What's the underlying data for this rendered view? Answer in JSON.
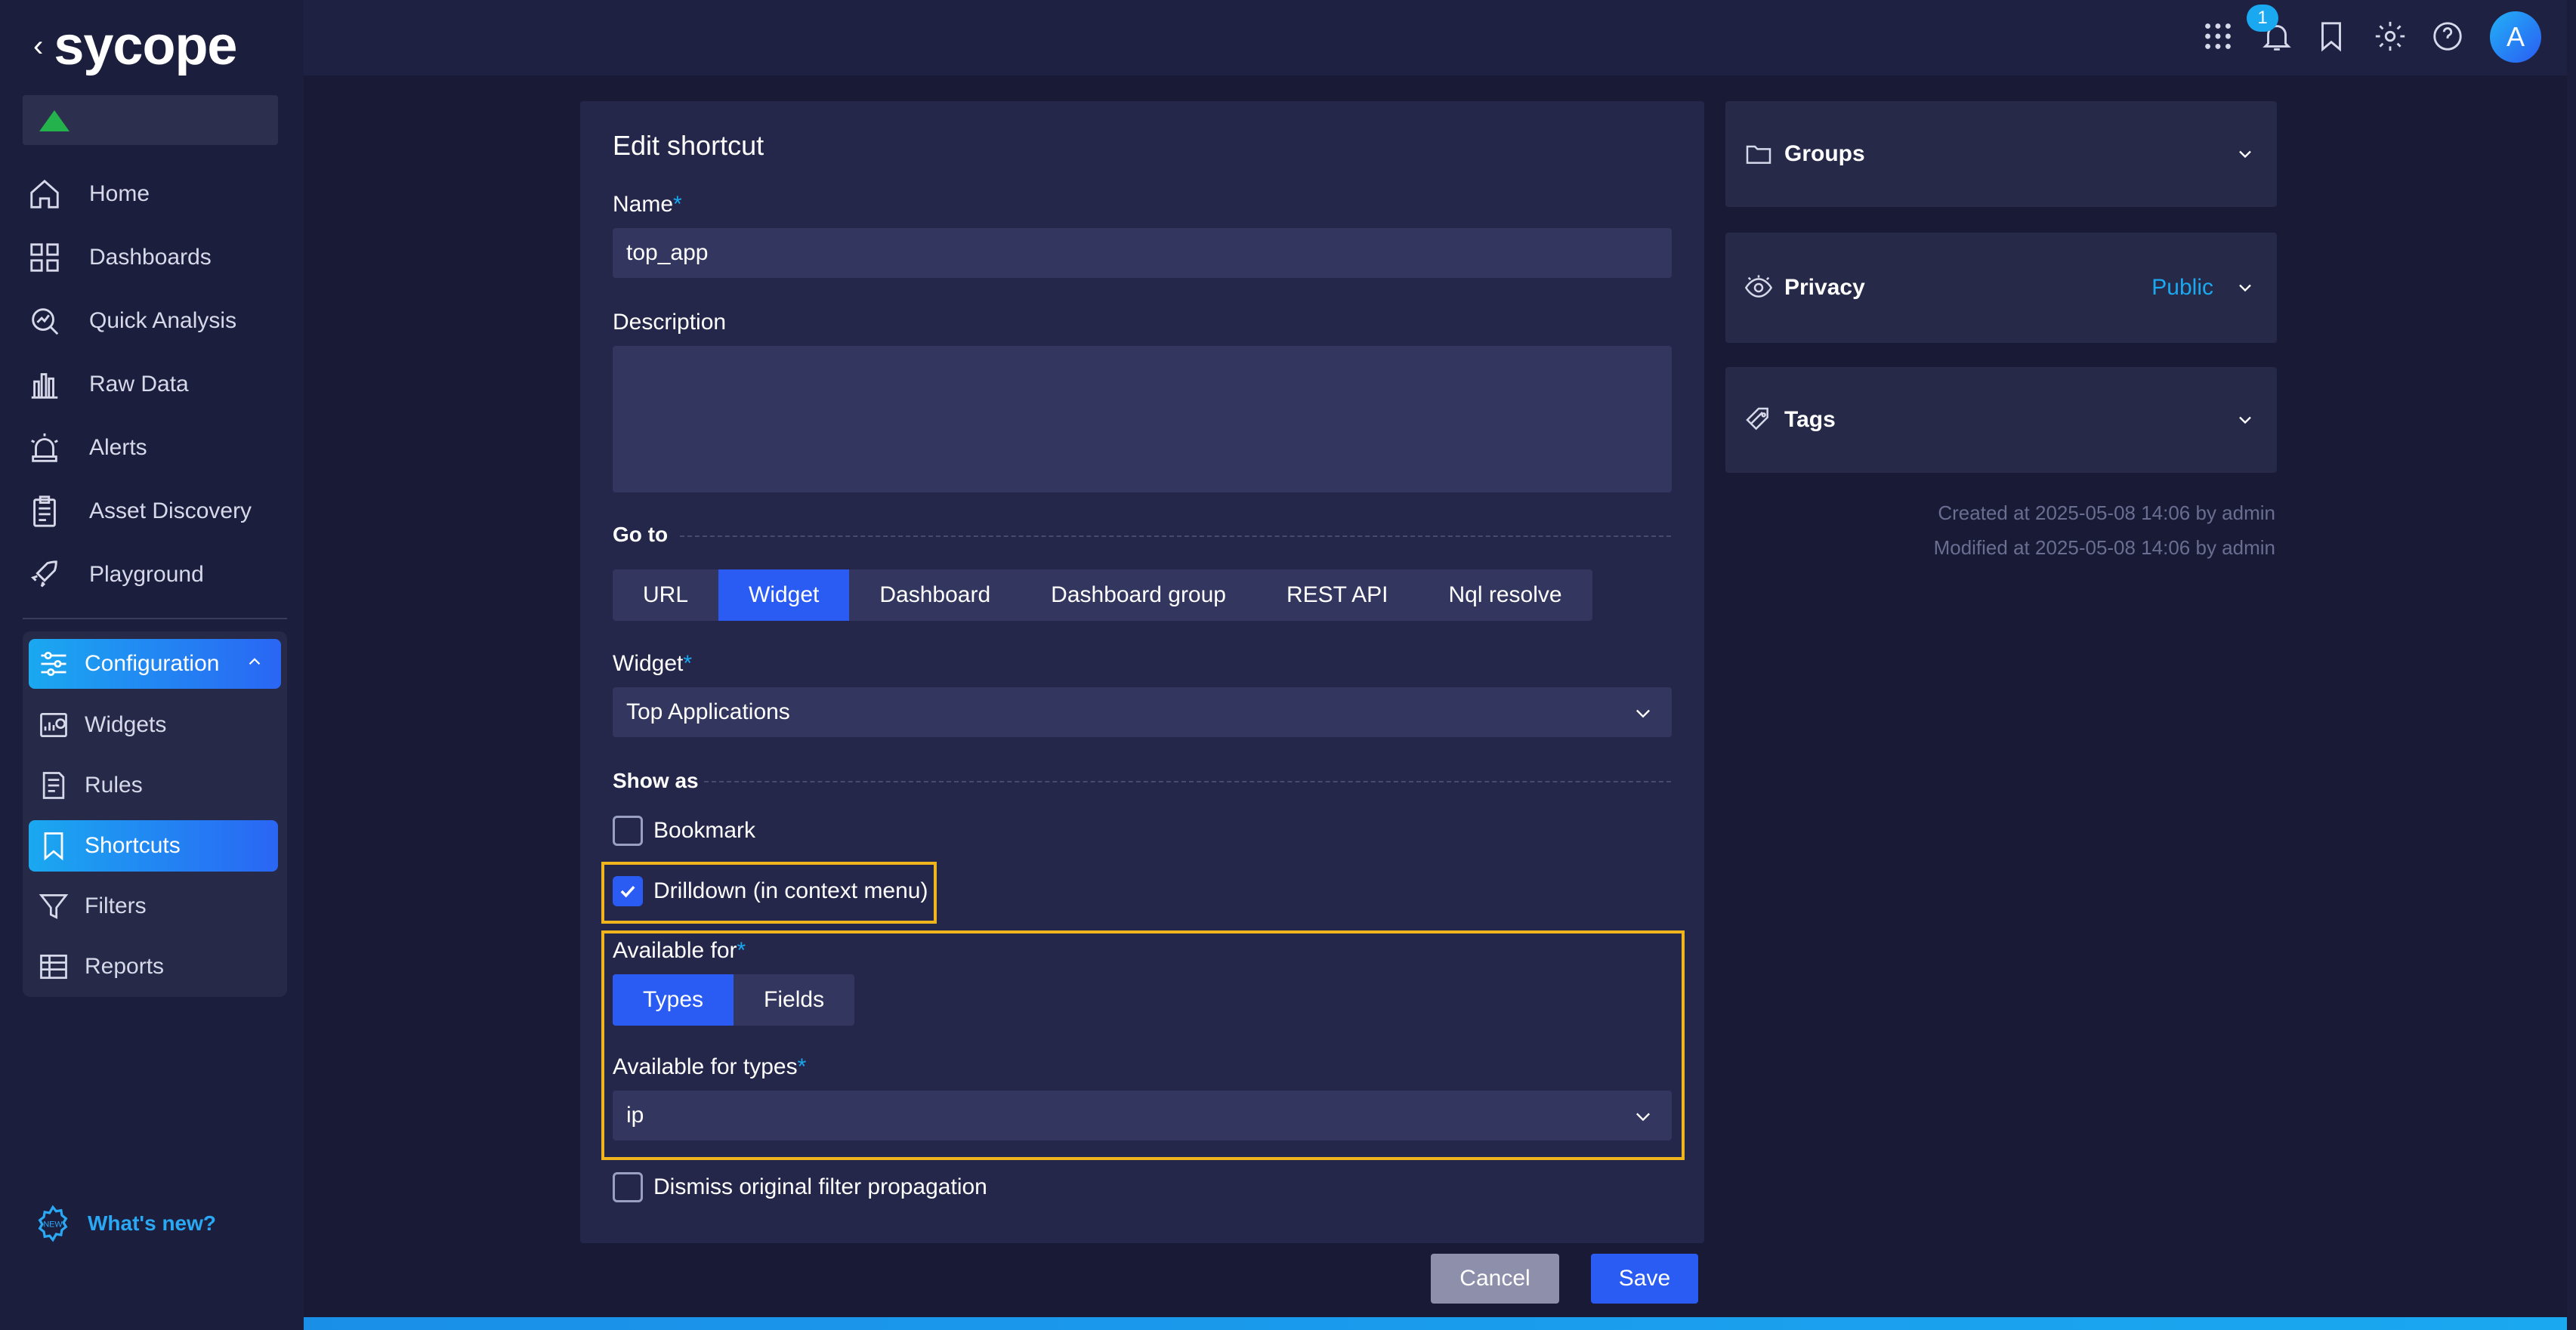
{
  "brand": {
    "logo_text": "sycope",
    "back_glyph": "‹"
  },
  "sidebar": {
    "items": [
      {
        "label": "Home",
        "icon": "home-icon"
      },
      {
        "label": "Dashboards",
        "icon": "dashboards-icon"
      },
      {
        "label": "Quick Analysis",
        "icon": "quick-analysis-icon"
      },
      {
        "label": "Raw Data",
        "icon": "raw-data-icon"
      },
      {
        "label": "Alerts",
        "icon": "alerts-icon"
      },
      {
        "label": "Asset Discovery",
        "icon": "asset-discovery-icon"
      },
      {
        "label": "Playground",
        "icon": "playground-icon"
      }
    ],
    "config": {
      "label": "Configuration",
      "items": [
        {
          "label": "Widgets",
          "icon": "widgets-icon"
        },
        {
          "label": "Rules",
          "icon": "rules-icon"
        },
        {
          "label": "Shortcuts",
          "icon": "shortcuts-icon",
          "active": true
        },
        {
          "label": "Filters",
          "icon": "filters-icon"
        },
        {
          "label": "Reports",
          "icon": "reports-icon"
        }
      ]
    },
    "whats_new": "What's new?"
  },
  "topbar": {
    "notification_count": "1",
    "avatar_initial": "A"
  },
  "form": {
    "title": "Edit shortcut",
    "name_label": "Name",
    "name_value": "top_app",
    "required_mark": "*",
    "description_label": "Description",
    "description_value": "",
    "goto_label": "Go to",
    "goto_tabs": [
      "URL",
      "Widget",
      "Dashboard",
      "Dashboard group",
      "REST API",
      "Nql resolve"
    ],
    "goto_active": "Widget",
    "widget_label": "Widget",
    "widget_value": "Top Applications",
    "show_as_label": "Show as",
    "bookmark_label": "Bookmark",
    "bookmark_checked": false,
    "drilldown_label": "Drilldown (in context menu)",
    "drilldown_checked": true,
    "available_for_label": "Available for",
    "available_for_tabs": [
      "Types",
      "Fields"
    ],
    "available_for_active": "Types",
    "available_types_label": "Available for types",
    "available_types_value": "ip",
    "dismiss_label": "Dismiss original filter propagation",
    "dismiss_checked": false,
    "cancel_label": "Cancel",
    "save_label": "Save"
  },
  "panels": {
    "groups_label": "Groups",
    "privacy_label": "Privacy",
    "privacy_value": "Public",
    "tags_label": "Tags",
    "created": "Created at 2025-05-08 14:06 by admin",
    "modified": "Modified at 2025-05-08 14:06 by admin"
  },
  "colors": {
    "accent": "#2a5cf3",
    "accent_light": "#1aa8f0",
    "highlight": "#f0b41c",
    "status_ok": "#23b24b"
  }
}
